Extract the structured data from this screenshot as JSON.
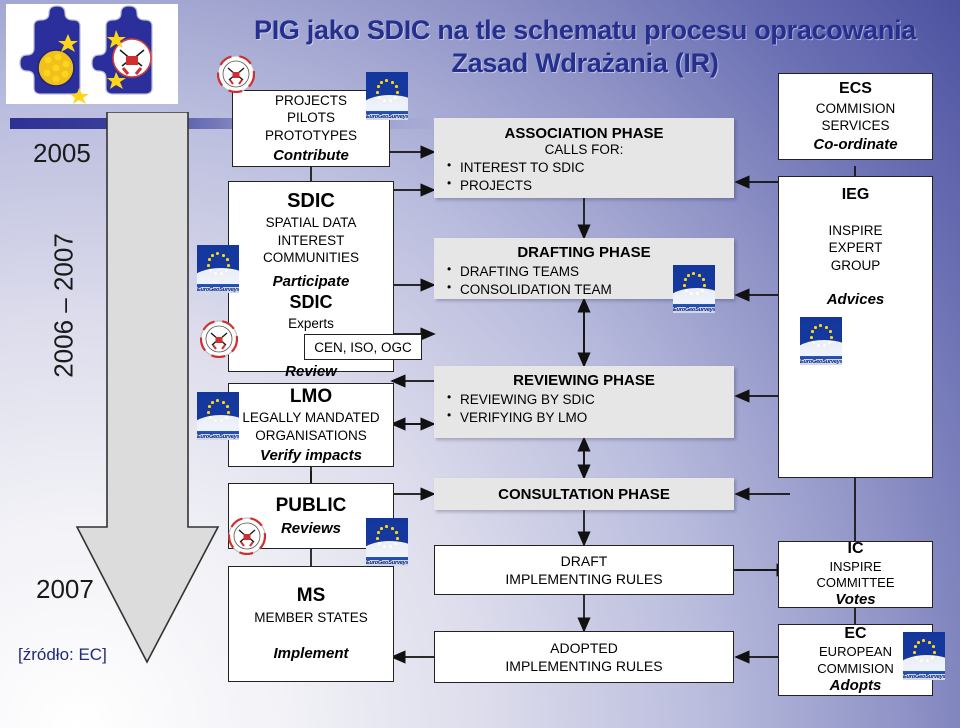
{
  "slide": {
    "title_line1": "PIG jako SDIC na tle schematu procesu opracowania",
    "title_line2": "Zasad Wdrażania (IR)",
    "source_note": "[źródło: EC]",
    "accent_blue": "#252f8e",
    "background_blue": "#4d52a0",
    "phase_fill": "#e6e6e6"
  },
  "timeline": {
    "years": [
      {
        "label": "2005"
      },
      {
        "label": "2006 – 2007"
      },
      {
        "label": "2007"
      }
    ]
  },
  "actors": [
    {
      "id": "projects",
      "title": "PROJECTS",
      "line2": "PILOTS",
      "line3": "PROTOTYPES",
      "action": "Contribute"
    },
    {
      "id": "sdic",
      "title": "SDIC",
      "line2": "SPATIAL DATA",
      "line3": "INTEREST",
      "line4": "COMMUNITIES",
      "action1": "Participate",
      "title2": "SDIC",
      "line5": "Experts",
      "standards": "CEN, ISO, OGC",
      "action2": "Review"
    },
    {
      "id": "lmo",
      "title": "LMO",
      "line2": "LEGALLY MANDATED",
      "line3": "ORGANISATIONS",
      "action": "Verify impacts"
    },
    {
      "id": "public",
      "title": "PUBLIC",
      "action": "Reviews"
    },
    {
      "id": "ms",
      "title": "MS",
      "line2": "MEMBER STATES",
      "action": "Implement"
    }
  ],
  "phases": [
    {
      "id": "association",
      "title": "ASSOCIATION PHASE",
      "subtitle": "CALLS FOR:",
      "bullets": [
        "INTEREST TO SDIC",
        "PROJECTS"
      ]
    },
    {
      "id": "drafting",
      "title": "DRAFTING PHASE",
      "bullets": [
        "DRAFTING TEAMS",
        "CONSOLIDATION TEAM"
      ]
    },
    {
      "id": "reviewing",
      "title": "REVIEWING PHASE",
      "bullets": [
        "REVIEWING BY SDIC",
        "VERIFYING BY LMO"
      ]
    },
    {
      "id": "consultation",
      "title": "CONSULTATION PHASE",
      "bullets": []
    }
  ],
  "outputs": [
    {
      "id": "draft-ir",
      "line1": "DRAFT",
      "line2": "IMPLEMENTING RULES"
    },
    {
      "id": "adopted-ir",
      "line1": "ADOPTED",
      "line2": "IMPLEMENTING RULES"
    }
  ],
  "institutions": [
    {
      "id": "ecs",
      "title": "ECS",
      "line2": "COMMISION",
      "line3": "SERVICES",
      "action": "Co-ordinate"
    },
    {
      "id": "ieg",
      "title": "IEG",
      "line2": "INSPIRE",
      "line3": "EXPERT",
      "line4": "GROUP",
      "action": "Advices"
    },
    {
      "id": "ic",
      "title": "IC",
      "line2": "INSPIRE",
      "line3": "COMMITTEE",
      "action": "Votes"
    },
    {
      "id": "ec",
      "title": "EC",
      "line2": "EUROPEAN",
      "line3": "COMMISION",
      "action": "Adopts"
    }
  ],
  "logos": {
    "eurogeosurveys_label": "EuroGeoSurveys"
  }
}
